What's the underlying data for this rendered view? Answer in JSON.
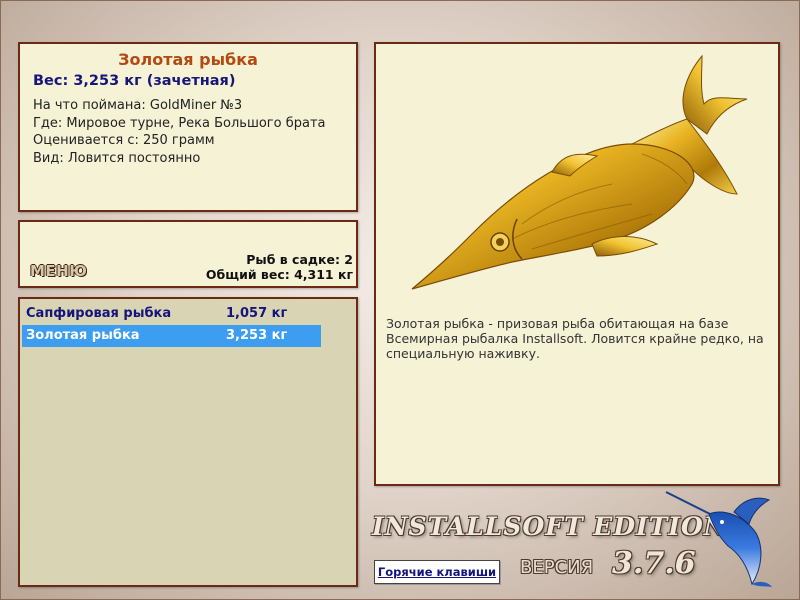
{
  "info": {
    "fish_name": "Золотая рыбка",
    "weight_line": "Вес: 3,253 кг (зачетная)",
    "caught_with": "На что поймана: GoldMiner №3",
    "where": "Где: Мировое турне, Река Большого брата",
    "rated_from": "Оценивается с: 250 грамм",
    "type": "Вид: Ловится постоянно"
  },
  "menu": {
    "label": "МЕНЮ",
    "fish_count": "Рыб в садке: 2",
    "total_weight": "Общий вес: 4,311 кг"
  },
  "catch_list": [
    {
      "name": "Сапфировая рыбка",
      "weight": "1,057 кг",
      "selected": false
    },
    {
      "name": "Золотая рыбка",
      "weight": "3,253 кг",
      "selected": true
    }
  ],
  "description": "Золотая рыбка - призовая рыба обитающая на базе Всемирная рыбалка Installsoft. Ловится крайне редко, на специальную наживку.",
  "footer": {
    "edition": "INSTALLSOFT EDITION",
    "version_label": "ВЕРСИЯ",
    "version_number": "3.7.6",
    "hotkeys": "Горячие клавиши"
  },
  "colors": {
    "panel_bg": "#f5f2d6",
    "panel_border": "#6b2a16",
    "selection": "#3d9df0",
    "fish_name": "#b34a12",
    "list_text": "#14147a"
  },
  "icons": {
    "fish_picture": "golden-fish-icon",
    "logo": "marlin-icon"
  }
}
